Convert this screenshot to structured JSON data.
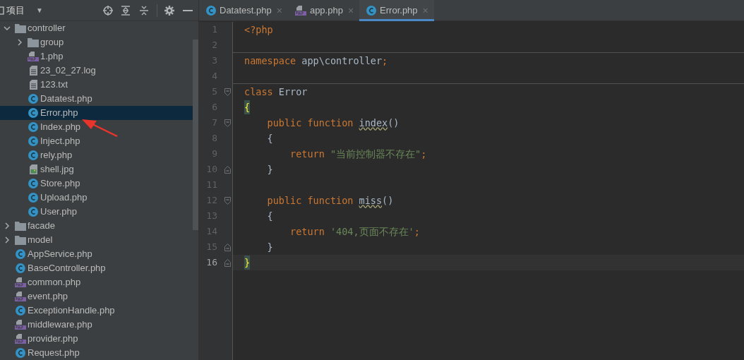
{
  "panel": {
    "title": "项目",
    "caret": "▼"
  },
  "tree": [
    {
      "name": "controller",
      "kind": "folder",
      "expanded": true,
      "selected": false,
      "children": [
        {
          "name": "group",
          "kind": "folder",
          "expanded": false,
          "selected": false
        },
        {
          "name": "1.php",
          "kind": "php",
          "selected": false
        },
        {
          "name": "23_02_27.log",
          "kind": "text",
          "selected": false
        },
        {
          "name": "123.txt",
          "kind": "text",
          "selected": false
        },
        {
          "name": "Datatest.php",
          "kind": "class",
          "selected": false
        },
        {
          "name": "Error.php",
          "kind": "class",
          "selected": true
        },
        {
          "name": "Index.php",
          "kind": "class",
          "selected": false
        },
        {
          "name": "Inject.php",
          "kind": "class",
          "selected": false
        },
        {
          "name": "rely.php",
          "kind": "class",
          "selected": false
        },
        {
          "name": "shell.jpg",
          "kind": "image",
          "selected": false
        },
        {
          "name": "Store.php",
          "kind": "class",
          "selected": false
        },
        {
          "name": "Upload.php",
          "kind": "class",
          "selected": false
        },
        {
          "name": "User.php",
          "kind": "class",
          "selected": false
        }
      ]
    },
    {
      "name": "facade",
      "kind": "folder",
      "expanded": false,
      "selected": false
    },
    {
      "name": "model",
      "kind": "folder",
      "expanded": false,
      "selected": false
    },
    {
      "name": "AppService.php",
      "kind": "class",
      "selected": false
    },
    {
      "name": "BaseController.php",
      "kind": "abstract",
      "selected": false
    },
    {
      "name": "common.php",
      "kind": "php",
      "selected": false
    },
    {
      "name": "event.php",
      "kind": "php",
      "selected": false
    },
    {
      "name": "ExceptionHandle.php",
      "kind": "class",
      "selected": false
    },
    {
      "name": "middleware.php",
      "kind": "php",
      "selected": false
    },
    {
      "name": "provider.php",
      "kind": "php",
      "selected": false
    },
    {
      "name": "Request.php",
      "kind": "class",
      "selected": false
    }
  ],
  "tabs": [
    {
      "label": "Datatest.php",
      "kind": "class",
      "selected": false,
      "close": "×"
    },
    {
      "label": "app.php",
      "kind": "php",
      "selected": false,
      "close": "×"
    },
    {
      "label": "Error.php",
      "kind": "class",
      "selected": true,
      "close": "×"
    }
  ],
  "code": [
    {
      "number": "1",
      "kind": "plain",
      "current": false,
      "tokens": [
        {
          "text": "<?php",
          "kind": "keyword"
        }
      ]
    },
    {
      "number": "2",
      "kind": "separator",
      "current": false
    },
    {
      "number": "3",
      "kind": "plain",
      "current": false,
      "tokens": [
        {
          "text": "namespace",
          "kind": "keyword"
        },
        {
          "text": " app\\controller",
          "kind": "text"
        },
        {
          "text": ";",
          "kind": "keyword"
        }
      ]
    },
    {
      "number": "4",
      "kind": "separator",
      "current": false
    },
    {
      "number": "5",
      "kind": "opener",
      "current": false,
      "tokens": [
        {
          "text": "class",
          "kind": "keyword"
        },
        {
          "text": " Error",
          "kind": "text"
        }
      ]
    },
    {
      "number": "6",
      "kind": "plain",
      "current": false,
      "tokens": [
        {
          "text": "{",
          "kind": "match"
        }
      ]
    },
    {
      "number": "7",
      "kind": "opener",
      "current": false,
      "tokens": [
        {
          "text": "    public function ",
          "kind": "keyword"
        },
        {
          "text": "index",
          "kind": "typo"
        },
        {
          "text": "()",
          "kind": "text"
        }
      ]
    },
    {
      "number": "8",
      "kind": "plain",
      "current": false,
      "tokens": [
        {
          "text": "    {",
          "kind": "text"
        }
      ]
    },
    {
      "number": "9",
      "kind": "plain",
      "current": false,
      "tokens": [
        {
          "text": "        return",
          "kind": "keyword"
        },
        {
          "text": " \"当前控制器不存在\"",
          "kind": "string"
        },
        {
          "text": ";",
          "kind": "keyword"
        }
      ]
    },
    {
      "number": "10",
      "kind": "closer",
      "current": false,
      "tokens": [
        {
          "text": "    }",
          "kind": "text"
        }
      ]
    },
    {
      "number": "11",
      "kind": "plain",
      "current": false
    },
    {
      "number": "12",
      "kind": "opener",
      "current": false,
      "tokens": [
        {
          "text": "    public function ",
          "kind": "keyword"
        },
        {
          "text": "miss",
          "kind": "typo"
        },
        {
          "text": "()",
          "kind": "text"
        }
      ]
    },
    {
      "number": "13",
      "kind": "plain",
      "current": false,
      "tokens": [
        {
          "text": "    {",
          "kind": "text"
        }
      ]
    },
    {
      "number": "14",
      "kind": "plain",
      "current": false,
      "tokens": [
        {
          "text": "        return",
          "kind": "keyword"
        },
        {
          "text": " '404,页面不存在'",
          "kind": "string"
        },
        {
          "text": ";",
          "kind": "keyword"
        }
      ]
    },
    {
      "number": "15",
      "kind": "closer",
      "current": false,
      "tokens": [
        {
          "text": "    }",
          "kind": "text"
        }
      ]
    },
    {
      "number": "16",
      "kind": "closer",
      "current": true,
      "tokens": [
        {
          "text": "}",
          "kind": "match"
        }
      ]
    }
  ]
}
